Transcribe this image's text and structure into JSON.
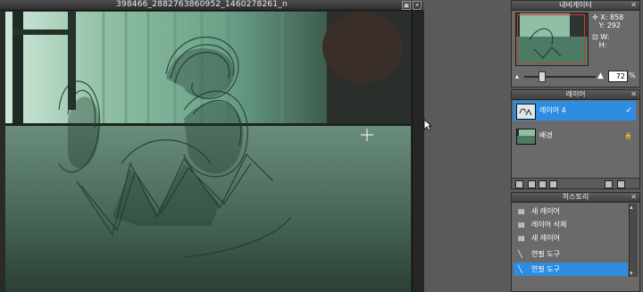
{
  "document": {
    "title": "398466_2882763860952_1460278261_n",
    "buttons": {
      "restore": "▣",
      "close": "✕"
    }
  },
  "navigator": {
    "title": "내비게이터",
    "x_label": "X:",
    "x_value": "858",
    "y_label": "Y:",
    "y_value": "292",
    "w_label": "W:",
    "h_label": "H:",
    "zoom_value": "72",
    "zoom_unit": "%"
  },
  "layers": {
    "title": "레이어",
    "items": [
      {
        "name": "레이어 4",
        "selected": true,
        "mark": "✓"
      },
      {
        "name": "배경",
        "selected": false,
        "mark": "🔒"
      }
    ]
  },
  "history": {
    "title": "히스토리",
    "items": [
      {
        "label": "새 레이어",
        "icon": "new-layer-icon",
        "selected": false
      },
      {
        "label": "레이어 삭제",
        "icon": "delete-layer-icon",
        "selected": false
      },
      {
        "label": "새 레이어",
        "icon": "new-layer-icon",
        "selected": false
      },
      {
        "label": "연필 도구",
        "icon": "pencil-icon",
        "selected": false
      },
      {
        "label": "연필 도구",
        "icon": "pencil-icon",
        "selected": true
      }
    ]
  },
  "colors": {
    "selection": "#2e8de0",
    "panel_bg": "#6a6a6a",
    "workspace": "#5a5a5a"
  }
}
